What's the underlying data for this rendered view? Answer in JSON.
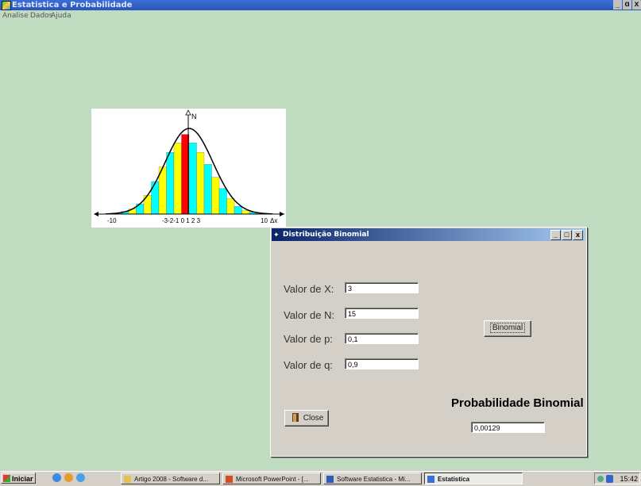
{
  "app": {
    "title": "Estatistica e Probabilidade",
    "controls": [
      "_",
      "ɑ",
      "x"
    ]
  },
  "menu": [
    "Analise",
    "Dados",
    "Ajuda"
  ],
  "chart": {
    "axis_label_n": "N",
    "tick_labels": [
      "-10",
      "-3-2-1 0 1 2 3",
      "10"
    ],
    "axis_label_x": "Δx",
    "bars": [
      0.01,
      0.03,
      0.06,
      0.12,
      0.22,
      0.38,
      0.55,
      0.72,
      0.83,
      0.93,
      0.83,
      0.72,
      0.58,
      0.43,
      0.3,
      0.18,
      0.09,
      0.04,
      0.02,
      0.01
    ],
    "bar_colors": [
      "#ffff00",
      "#00ffff",
      "#ffff00",
      "#00ffff",
      "#ffff00",
      "#00ffff",
      "#ffff00",
      "#00ffff",
      "#ffff00",
      "#ff0000",
      "#00ffff",
      "#ffff00",
      "#00ffff",
      "#ffff00",
      "#00ffff",
      "#ffff00",
      "#00ffff",
      "#ffff00",
      "#00ffff",
      "#ffff00"
    ]
  },
  "dialog": {
    "title": "Distribuição Binomial",
    "controls": [
      "_",
      "□",
      "x"
    ],
    "fields": [
      {
        "label": "Valor de X:",
        "value": "3"
      },
      {
        "label": "Valor de N:",
        "value": "15"
      },
      {
        "label": "Valor de p:",
        "value": "0,1"
      },
      {
        "label": "Valor de q:",
        "value": "0,9"
      }
    ],
    "binomial_button": "Binomial",
    "close_button": "Close",
    "result_title": "Probabilidade Binomial",
    "result_value": "0,00129"
  },
  "taskbar": {
    "start": "Iniciar",
    "tasks": [
      "Artigo 2008 - Software d...",
      "Microsoft PowerPoint - [...",
      "Software Estatistica - Mi...",
      "Estatistica"
    ],
    "clock": "15:42"
  }
}
